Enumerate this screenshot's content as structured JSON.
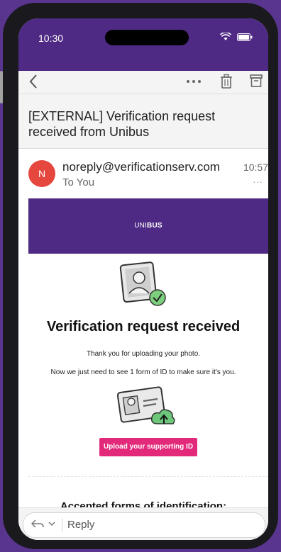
{
  "status": {
    "time": "10:30"
  },
  "email": {
    "subject": "[EXTERNAL] Verification request received from Unibus",
    "avatar_letter": "N",
    "sender": "noreply@verificationserv.com",
    "to": "To You",
    "time": "10:57",
    "more": "···"
  },
  "content": {
    "banner_brand_light": "UNI",
    "banner_brand_bold": "BUS",
    "heading": "Verification request received",
    "line1": "Thank you for uploading your photo.",
    "line2": "Now we just need to see 1 form of ID to make sure it's you.",
    "cta": "Upload your supporting ID",
    "accepted_heading": "Accepted forms of identification:"
  },
  "reply": {
    "label": "Reply"
  },
  "colors": {
    "header": "#4e2a84",
    "cta": "#e2297a",
    "avatar": "#e5473e"
  },
  "icons": [
    "back-icon",
    "more-icon",
    "trash-icon",
    "archive-icon",
    "wifi-icon",
    "battery-icon",
    "reply-icon",
    "chevron-down-icon"
  ]
}
